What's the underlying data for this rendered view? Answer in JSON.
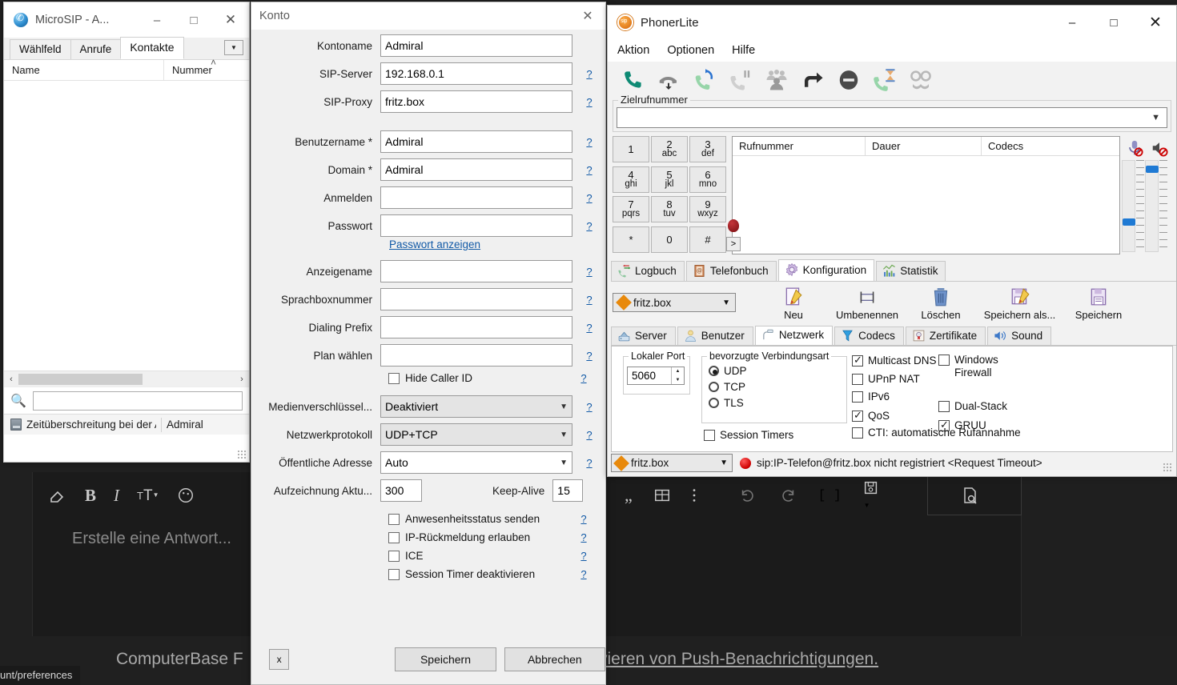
{
  "background": {
    "toolbar_icons": [
      "quote-icon",
      "table-icon",
      "more-vertical-icon",
      "undo-icon",
      "redo-icon",
      "code-brackets-icon",
      "save-dropdown-icon",
      "preview-icon"
    ],
    "reply_placeholder": "Erstelle eine Antwort...",
    "footer_text": "ComputerBase F",
    "footer_link": "vieren von Push-Benachrichtigungen.",
    "status_url": "unt/preferences"
  },
  "microsip": {
    "title": "MicroSIP - A...",
    "icon": "phone-globe-icon",
    "window_buttons": {
      "minimize": "–",
      "maximize": "□",
      "close": "✕"
    },
    "tabs": [
      {
        "label": "Wählfeld",
        "active": false
      },
      {
        "label": "Anrufe",
        "active": false
      },
      {
        "label": "Kontakte",
        "active": true
      }
    ],
    "tabs_dropdown_icon": "chevron-down-icon",
    "columns": [
      "Name",
      "Nummer"
    ],
    "sort_indicator": "˄",
    "rows": [],
    "hscroll": {
      "left_arrow": "‹",
      "right_arrow": "›"
    },
    "search_icon": "search-icon",
    "search_value": "",
    "status": {
      "icon": "account-icon",
      "message": "Zeitüberschreitung bei der A…",
      "account": "Admiral"
    }
  },
  "konto": {
    "title": "Konto",
    "close_icon": "close-icon",
    "help_marker": "?",
    "fields": [
      {
        "label": "Kontoname",
        "value": "Admiral",
        "help": false
      },
      {
        "label": "SIP-Server",
        "value": "192.168.0.1",
        "help": true
      },
      {
        "label": "SIP-Proxy",
        "value": "fritz.box",
        "help": true
      },
      {
        "label": "Benutzername *",
        "value": "Admiral",
        "help": true
      },
      {
        "label": "Domain *",
        "value": "Admiral",
        "help": true
      },
      {
        "label": "Anmelden",
        "value": "",
        "help": true
      },
      {
        "label": "Passwort",
        "value": "",
        "help": true
      }
    ],
    "password_link": "Passwort anzeigen",
    "fields2": [
      {
        "label": "Anzeigename",
        "value": "",
        "help": true
      },
      {
        "label": "Sprachboxnummer",
        "value": "",
        "help": true
      },
      {
        "label": "Dialing Prefix",
        "value": "",
        "help": true
      },
      {
        "label": "Plan wählen",
        "value": "",
        "help": true
      }
    ],
    "hide_caller_id": {
      "label": "Hide Caller ID",
      "checked": false,
      "help": true
    },
    "selects": [
      {
        "label": "Medienverschlüssel...",
        "value": "Deaktiviert",
        "help": true
      },
      {
        "label": "Netzwerkprotokoll",
        "value": "UDP+TCP",
        "help": true
      },
      {
        "label": "Öffentliche Adresse",
        "value": "Auto",
        "help": true
      }
    ],
    "registration": {
      "label": "Aufzeichnung Aktu...",
      "value": "300",
      "keepalive_label": "Keep-Alive",
      "keepalive_value": "15"
    },
    "checkboxes": [
      {
        "label": "Anwesenheitsstatus senden",
        "checked": false,
        "help": true
      },
      {
        "label": "IP-Rückmeldung erlauben",
        "checked": false,
        "help": true
      },
      {
        "label": "ICE",
        "checked": false,
        "help": true
      },
      {
        "label": "Session Timer deaktivieren",
        "checked": false,
        "help": true
      }
    ],
    "buttons": {
      "x": "x",
      "save": "Speichern",
      "cancel": "Abbrechen"
    }
  },
  "phonerlite": {
    "title": "PhonerLite",
    "logo": "sip-ball-icon",
    "window_buttons": {
      "minimize": "–",
      "maximize": "□",
      "close": "✕"
    },
    "menu": [
      "Aktion",
      "Optionen",
      "Hilfe"
    ],
    "toolbar_icons": [
      "call-answer-icon",
      "hangup-icon",
      "redial-icon",
      "hold-icon",
      "conference-icon",
      "transfer-icon",
      "dnd-icon",
      "call-waiting-icon",
      "anonymous-icon"
    ],
    "target_group": "Zielrufnummer",
    "target_value": "",
    "target_chevron": "chevron-down-icon",
    "dialpad": [
      {
        "digit": "1",
        "letters": ""
      },
      {
        "digit": "2",
        "letters": "abc"
      },
      {
        "digit": "3",
        "letters": "def"
      },
      {
        "digit": "4",
        "letters": "ghi"
      },
      {
        "digit": "5",
        "letters": "jkl"
      },
      {
        "digit": "6",
        "letters": "mno"
      },
      {
        "digit": "7",
        "letters": "pqrs"
      },
      {
        "digit": "8",
        "letters": "tuv"
      },
      {
        "digit": "9",
        "letters": "wxyz"
      },
      {
        "digit": "*",
        "letters": ""
      },
      {
        "digit": "0",
        "letters": ""
      },
      {
        "digit": "#",
        "letters": ""
      }
    ],
    "dial_more": ">",
    "record_icon": "record-icon",
    "call_columns": [
      "Rufnummer",
      "Dauer",
      "Codecs"
    ],
    "call_rows": [],
    "volume": {
      "mic_icon": "microphone-muted-icon",
      "speaker_icon": "speaker-muted-icon",
      "mic_level": 22,
      "speaker_level": 88
    },
    "tabs": [
      {
        "label": "Logbuch",
        "icon": "call-log-icon",
        "active": false
      },
      {
        "label": "Telefonbuch",
        "icon": "phonebook-icon",
        "active": false
      },
      {
        "label": "Konfiguration",
        "icon": "gear-icon",
        "active": true
      },
      {
        "label": "Statistik",
        "icon": "chart-icon",
        "active": false
      }
    ],
    "profile": {
      "value": "fritz.box",
      "icon": "profile-icon",
      "chevron": "chevron-down-icon"
    },
    "config_buttons": [
      {
        "label": "Neu",
        "icon": "new-document-icon"
      },
      {
        "label": "Umbenennen",
        "icon": "rename-icon"
      },
      {
        "label": "Löschen",
        "icon": "trash-icon"
      },
      {
        "label": "Speichern als...",
        "icon": "save-as-icon"
      },
      {
        "label": "Speichern",
        "icon": "save-icon"
      }
    ],
    "subtabs": [
      {
        "label": "Server",
        "icon": "server-icon",
        "active": false
      },
      {
        "label": "Benutzer",
        "icon": "user-icon",
        "active": false
      },
      {
        "label": "Netzwerk",
        "icon": "network-icon",
        "active": true
      },
      {
        "label": "Codecs",
        "icon": "codecs-icon",
        "active": false
      },
      {
        "label": "Zertifikate",
        "icon": "certificate-icon",
        "active": false
      },
      {
        "label": "Sound",
        "icon": "speaker-icon",
        "active": false
      }
    ],
    "network": {
      "local_port_label": "Lokaler Port",
      "local_port_value": "5060",
      "spin_up": "▲",
      "spin_down": "▼",
      "conn_group_label": "bevorzugte Verbindungsart",
      "conn_options": [
        {
          "label": "UDP",
          "selected": true
        },
        {
          "label": "TCP",
          "selected": false
        },
        {
          "label": "TLS",
          "selected": false
        }
      ],
      "session_timers": {
        "label": "Session Timers",
        "checked": false
      },
      "col1": [
        {
          "label": "Multicast DNS",
          "checked": true
        },
        {
          "label": "UPnP NAT",
          "checked": false
        },
        {
          "label": "IPv6",
          "checked": false
        },
        {
          "label": "QoS",
          "checked": true
        }
      ],
      "col2": [
        {
          "label": "Windows Firewall",
          "checked": false
        },
        {
          "label": "Dual-Stack",
          "checked": false
        },
        {
          "label": "GRUU",
          "checked": true
        }
      ],
      "cti": {
        "label": "CTI: automatische Rufannahme",
        "checked": false
      }
    },
    "status": {
      "profile": "fritz.box",
      "chevron": "chevron-down-icon",
      "dot": "error-dot-icon",
      "message": "sip:IP-Telefon@fritz.box nicht registriert <Request Timeout>"
    }
  }
}
